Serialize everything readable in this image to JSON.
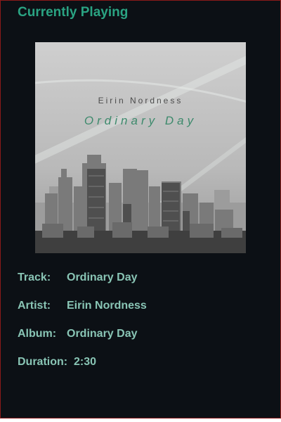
{
  "header": {
    "title": "Currently Playing"
  },
  "cover": {
    "artist": "Eirin Nordness",
    "title": "Ordinary Day"
  },
  "info": {
    "track_label": "Track:",
    "track_value": "Ordinary Day",
    "artist_label": "Artist:",
    "artist_value": "Eirin Nordness",
    "album_label": "Album:",
    "album_value": "Ordinary Day",
    "duration_label": "Duration:",
    "duration_value": "2:30"
  },
  "colors": {
    "background": "#0c1015",
    "title": "#2aa382",
    "info_text": "#89c5b5",
    "border": "#8b1a1a"
  }
}
